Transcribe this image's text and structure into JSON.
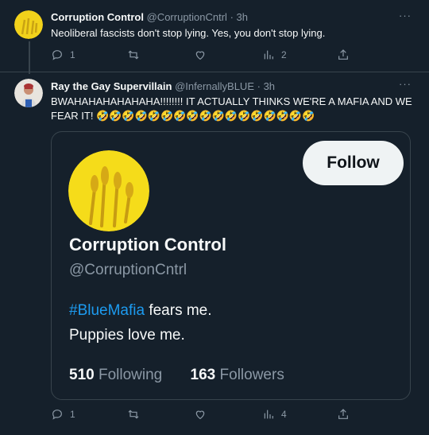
{
  "tweets": [
    {
      "name": "Corruption Control",
      "handle": "@CorruptionCntrl",
      "time": "3h",
      "more": "···",
      "text": "Neoliberal fascists don't stop lying.  Yes, you don't stop lying.",
      "replies": "1",
      "retweets": "",
      "likes": "",
      "views": "2"
    },
    {
      "name": "Ray the Gay Supervillain",
      "handle": "@InfernallyBLUE",
      "time": "3h",
      "more": "···",
      "text": "BWAHAHAHAHAHAHA!!!!!!!! IT ACTUALLY THINKS WE'RE A MAFIA AND WE FEAR IT! 🤣🤣🤣🤣🤣🤣🤣🤣🤣🤣🤣🤣🤣🤣🤣🤣🤣",
      "replies": "1",
      "retweets": "",
      "likes": "",
      "views": "4"
    }
  ],
  "card": {
    "follow_label": "Follow",
    "name": "Corruption Control",
    "handle": "@CorruptionCntrl",
    "hashtag": "#BlueMafia",
    "bio_rest": " fears me.",
    "bio_line2": "Puppies love me.",
    "following_count": "510",
    "following_label": "Following",
    "followers_count": "163",
    "followers_label": "Followers"
  },
  "colors": {
    "background": "#15202b",
    "text": "#f7f9f9",
    "muted": "#8b98a5",
    "accent": "#1d9bf0",
    "border": "#38444d"
  }
}
